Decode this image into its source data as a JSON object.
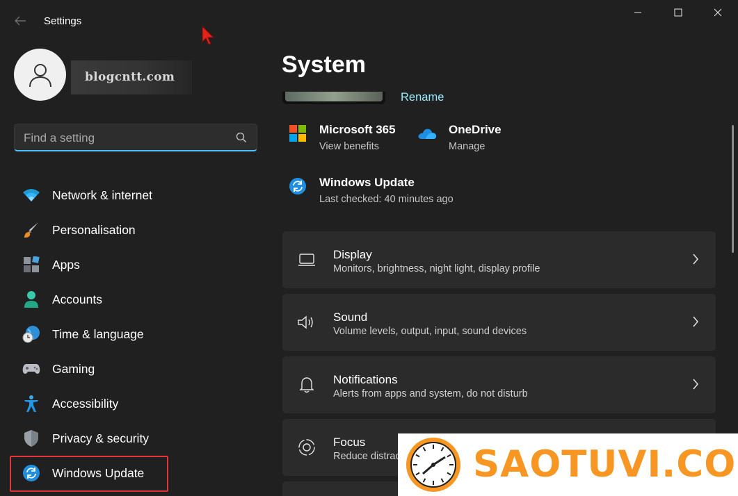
{
  "window": {
    "title": "Settings",
    "controls": {
      "minimize": "—",
      "maximize": "☐",
      "close": "✕"
    }
  },
  "account": {
    "name": "blogcntt.com"
  },
  "search": {
    "placeholder": "Find a setting"
  },
  "sidebar": {
    "items": [
      {
        "label": "Network & internet",
        "icon": "wifi-icon"
      },
      {
        "label": "Personalisation",
        "icon": "brush-icon"
      },
      {
        "label": "Apps",
        "icon": "apps-icon"
      },
      {
        "label": "Accounts",
        "icon": "person-icon"
      },
      {
        "label": "Time & language",
        "icon": "globe-clock-icon"
      },
      {
        "label": "Gaming",
        "icon": "gamepad-icon"
      },
      {
        "label": "Accessibility",
        "icon": "accessibility-icon"
      },
      {
        "label": "Privacy & security",
        "icon": "shield-icon"
      },
      {
        "label": "Windows Update",
        "icon": "update-icon",
        "highlighted": true
      }
    ]
  },
  "main": {
    "title": "System",
    "rename_label": "Rename",
    "quick_links": [
      {
        "title": "Microsoft 365",
        "subtitle": "View benefits",
        "icon": "microsoft-logo-icon"
      },
      {
        "title": "OneDrive",
        "subtitle": "Manage",
        "icon": "cloud-icon"
      },
      {
        "title": "Windows Update",
        "subtitle": "Last checked: 40 minutes ago",
        "icon": "update-icon"
      }
    ],
    "cards": [
      {
        "title": "Display",
        "subtitle": "Monitors, brightness, night light, display profile",
        "icon": "display-icon"
      },
      {
        "title": "Sound",
        "subtitle": "Volume levels, output, input, sound devices",
        "icon": "speaker-icon"
      },
      {
        "title": "Notifications",
        "subtitle": "Alerts from apps and system, do not disturb",
        "icon": "bell-icon"
      },
      {
        "title": "Focus",
        "subtitle": "Reduce distractions",
        "icon": "focus-icon"
      }
    ]
  },
  "watermark": {
    "text": "SAOTUVI.COM"
  },
  "colors": {
    "background": "#202020",
    "card": "#2b2b2b",
    "accent": "#4cc2ff",
    "link": "#99ebff",
    "highlight_box": "#e0343a",
    "watermark_orange": "#f79622"
  }
}
